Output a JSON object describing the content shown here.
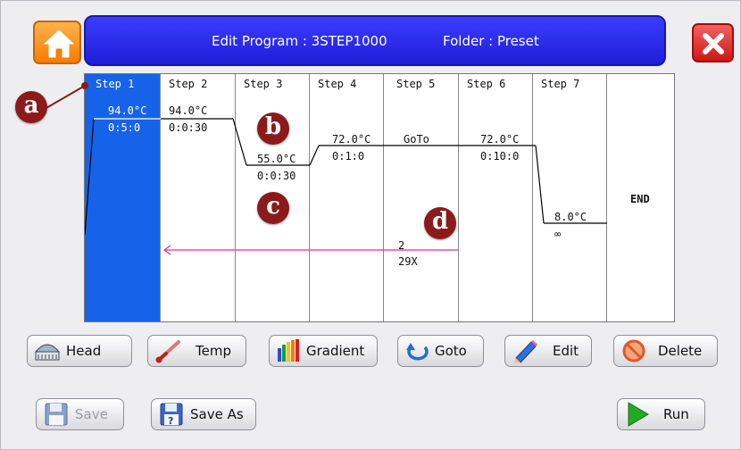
{
  "header": {
    "title": "Edit Program : 3STEP1000",
    "folder": "Folder : Preset"
  },
  "steps": [
    {
      "name": "Step 1",
      "temp": "94.0°C",
      "time": "0:5:0"
    },
    {
      "name": "Step 2",
      "temp": "94.0°C",
      "time": "0:0:30"
    },
    {
      "name": "Step 3",
      "temp": "55.0°C",
      "time": "0:0:30"
    },
    {
      "name": "Step 4",
      "temp": "72.0°C",
      "time": "0:1:0"
    },
    {
      "name": "Step 5",
      "temp": "GoTo",
      "goto_target": "2",
      "goto_repeat": "29X"
    },
    {
      "name": "Step 6",
      "temp": "72.0°C",
      "time": "0:10:0"
    },
    {
      "name": "Step 7",
      "temp": "8.0°C",
      "time": "∞"
    }
  ],
  "end_label": "END",
  "selected_step": "Step 1",
  "callouts": [
    "a",
    "b",
    "c",
    "d"
  ],
  "toolbar": {
    "head": "Head",
    "temp": "Temp",
    "gradient": "Gradient",
    "goto": "Goto",
    "edit": "Edit",
    "delete": "Delete",
    "save": "Save",
    "save_as": "Save As",
    "run": "Run"
  },
  "icons": {
    "home": "home-icon",
    "close": "close-icon",
    "head": "heated-lid-icon",
    "temp": "thermometer-icon",
    "gradient": "gradient-bars-icon",
    "goto": "loop-arrow-icon",
    "edit": "pencil-icon",
    "delete": "prohibit-icon",
    "save": "floppy-disk-icon",
    "save_as": "floppy-question-icon",
    "run": "play-icon"
  },
  "colors": {
    "title_bar": "#2424e6",
    "selected_step": "#1663ea",
    "home": "#f57d00",
    "close": "#cf1616",
    "callout": "#8c1a1a",
    "goto_arrow": "#e0308a",
    "run": "#22aa22"
  }
}
